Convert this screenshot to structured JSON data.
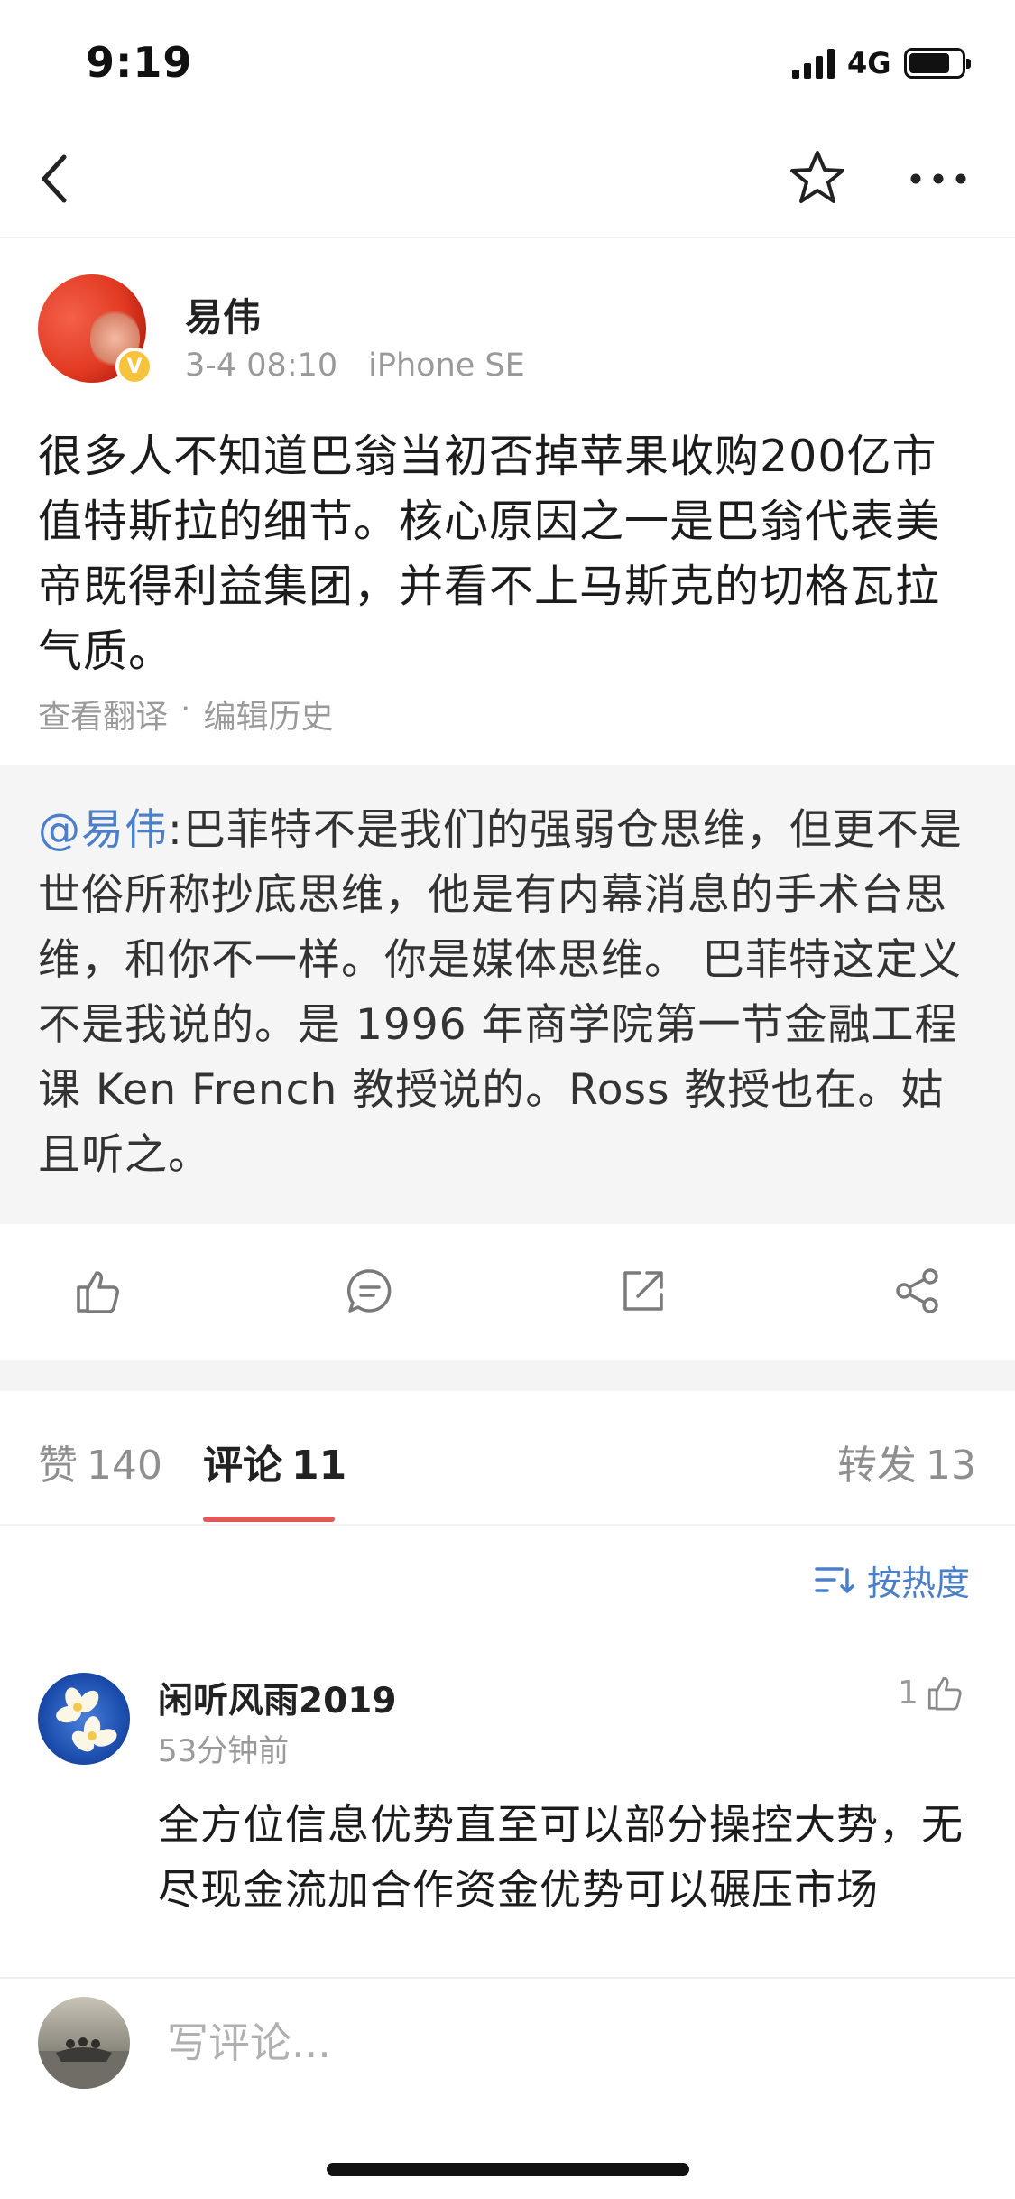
{
  "status_bar": {
    "time": "9:19",
    "network": "4G"
  },
  "post": {
    "author": "易伟",
    "time": "3-4 08:10",
    "device": "iPhone SE",
    "text": "很多人不知道巴翁当初否掉苹果收购200亿市值特斯拉的细节。核心原因之一是巴翁代表美帝既得利益集团，并看不上马斯克的切格瓦拉气质。",
    "translate_link": "查看翻译",
    "separator": "·",
    "edit_history_link": "编辑历史"
  },
  "quoted": {
    "mention": "@易伟",
    "text": ":巴菲特不是我们的强弱仓思维，但更不是世俗所称抄底思维，他是有内幕消息的手术台思维，和你不一样。你是媒体思维。 巴菲特这定义不是我说的。是 1996 年商学院第一节金融工程课 Ken French 教授说的。Ross 教授也在。姑且听之。"
  },
  "tabs": {
    "likes_label": "赞",
    "likes_count": "140",
    "comments_label": "评论",
    "comments_count": "11",
    "reposts_label": "转发",
    "reposts_count": "13"
  },
  "sort": {
    "label": "按热度"
  },
  "comment": {
    "user": "闲听风雨2019",
    "time": "53分钟前",
    "likes": "1",
    "text": "全方位信息优势直至可以部分操控大势，无尽现金流加合作资金优势可以碾压市场"
  },
  "input": {
    "placeholder": "写评论..."
  },
  "colors": {
    "accent": "#e25858",
    "link": "#4b7fc9",
    "verified": "#f7c23c"
  }
}
